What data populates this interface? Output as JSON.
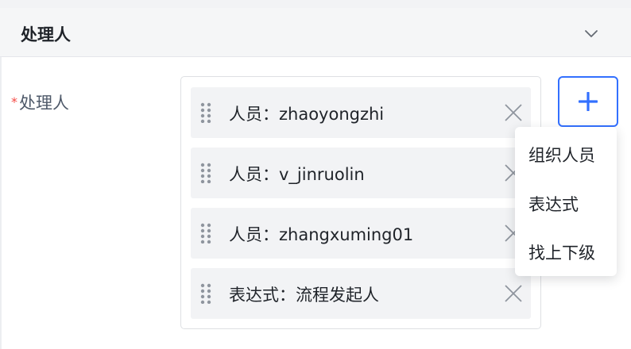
{
  "section": {
    "title": "处理人"
  },
  "field": {
    "required_mark": "*",
    "label": "处理人"
  },
  "assignees": [
    {
      "text": "人员：zhaoyongzhi"
    },
    {
      "text": "人员：v_jinruolin"
    },
    {
      "text": "人员：zhangxuming01"
    },
    {
      "text": "表达式：流程发起人"
    }
  ],
  "add_menu": {
    "items": [
      {
        "label": "组织人员"
      },
      {
        "label": "表达式"
      },
      {
        "label": "找上下级"
      }
    ]
  },
  "colors": {
    "accent": "#3370ff",
    "required": "#f54a45",
    "item_bg": "#f2f3f5",
    "header_bg": "#f5f6f7"
  },
  "icons": {
    "collapse": "chevron-down-icon",
    "drag": "drag-handle-icon",
    "remove": "close-icon",
    "add": "plus-icon"
  }
}
